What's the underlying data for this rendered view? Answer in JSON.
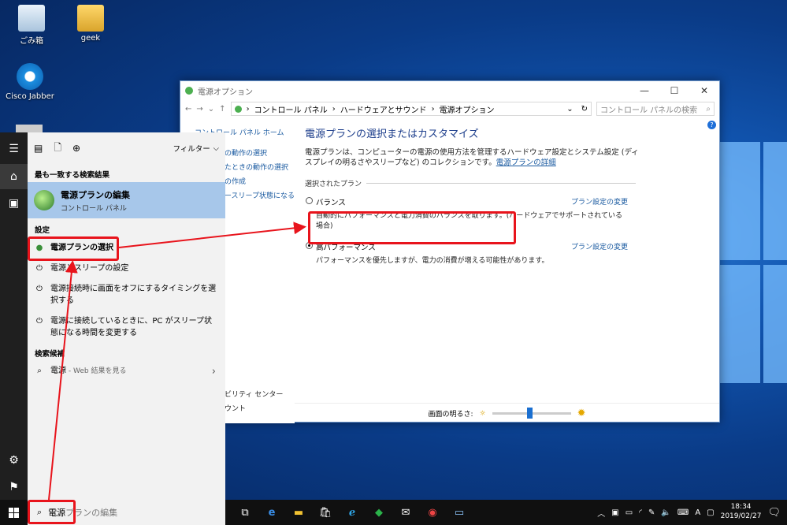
{
  "desktop": {
    "icons": [
      {
        "label": "ごみ箱"
      },
      {
        "label": "geek"
      },
      {
        "label": "Cisco Jabber"
      }
    ]
  },
  "window": {
    "title": "電源オプション",
    "controls": {
      "minimize": "—",
      "maximize": "☐",
      "close": "✕"
    },
    "breadcrumb": [
      "コントロール パネル",
      "ハードウェアとサウンド",
      "電源オプション"
    ],
    "search_placeholder": "コントロール パネルの検索",
    "sidebar": [
      "コントロール パネル ホーム",
      "の動作の選択",
      "たときの動作の選択",
      "の作成",
      "ースリープ状態になる",
      "ビリティ センター",
      "ウント"
    ],
    "heading": "電源プランの選択またはカスタマイズ",
    "description": "電源プランは、コンピューターの電源の使用方法を管理するハードウェア設定とシステム設定 (ディスプレイの明るさやスリープなど) のコレクションです。",
    "details_link": "電源プランの詳細",
    "group_label": "選択されたプラン",
    "plans": [
      {
        "name": "バランス",
        "description": "自動的にパフォーマンスと電力消費のバランスを取ります。(ハードウェアでサポートされている場合)",
        "change": "プラン設定の変更",
        "selected": false
      },
      {
        "name": "高パフォーマンス",
        "description": "パフォーマンスを優先しますが、電力の消費が増える可能性があります。",
        "change": "プラン設定の変更",
        "selected": true
      }
    ],
    "brightness_label": "画面の明るさ:",
    "brightness_level": 0.48
  },
  "start_menu": {
    "filter_label": "フィルター",
    "best_match_header": "最も一致する検索結果",
    "best_match": {
      "title": "電源プランの編集",
      "subtitle": "コントロール パネル"
    },
    "settings_header": "設定",
    "settings": [
      {
        "text": "電源プランの選択"
      },
      {
        "text": "電源とスリープの設定"
      },
      {
        "text": "電源接続時に画面をオフにするタイミングを選択する"
      },
      {
        "text": "電源に接続しているときに、PC がスリープ状態になる時間を変更する"
      }
    ],
    "suggestions_header": "検索候補",
    "suggestion": {
      "text": "電源",
      "suffix": " - Web 結果を見る"
    }
  },
  "taskbar": {
    "search_text": "電源",
    "search_hint": "プランの編集",
    "ime": "A",
    "time": "18:34",
    "date": "2019/02/27"
  },
  "colors": {
    "highlight": "#e8141c",
    "accent": "#1a6fd0",
    "best_match_bg": "#a7c7ea"
  }
}
